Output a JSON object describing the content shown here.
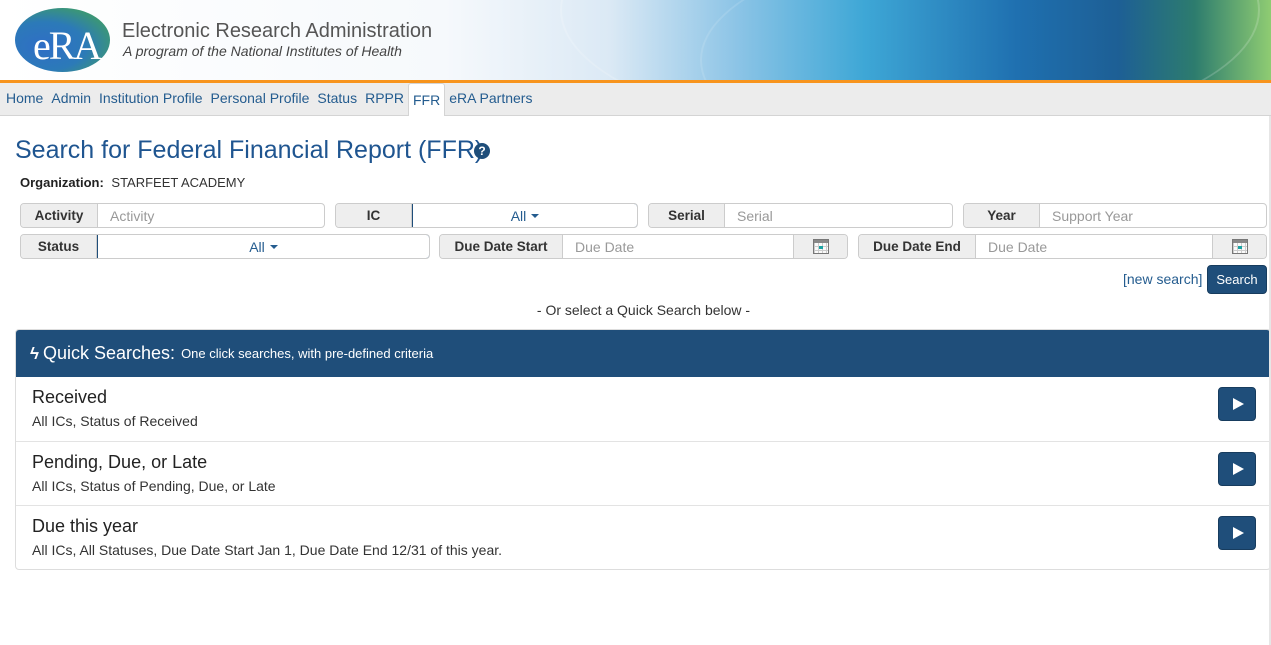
{
  "header": {
    "logo_text": "eRA",
    "title": "Electronic Research Administration",
    "subtitle": "A program of the National Institutes of Health",
    "accent_color": "#f7941d"
  },
  "nav": {
    "items": [
      {
        "label": "Home",
        "active": false
      },
      {
        "label": "Admin",
        "active": false
      },
      {
        "label": "Institution Profile",
        "active": false
      },
      {
        "label": "Personal Profile",
        "active": false
      },
      {
        "label": "Status",
        "active": false
      },
      {
        "label": "RPPR",
        "active": false
      },
      {
        "label": "FFR",
        "active": true
      },
      {
        "label": "eRA Partners",
        "active": false
      }
    ]
  },
  "page": {
    "title": "Search for Federal Financial Report (FFR)",
    "help_icon": "?",
    "organization_label": "Organization:",
    "organization_value": "STARFEET ACADEMY"
  },
  "search": {
    "activity": {
      "label": "Activity",
      "placeholder": "Activity",
      "value": ""
    },
    "ic": {
      "label": "IC",
      "value": "All"
    },
    "serial": {
      "label": "Serial",
      "placeholder": "Serial",
      "value": ""
    },
    "year": {
      "label": "Year",
      "placeholder": "Support Year",
      "value": ""
    },
    "status": {
      "label": "Status",
      "value": "All"
    },
    "due_date_start": {
      "label": "Due Date Start",
      "placeholder": "Due Date",
      "value": ""
    },
    "due_date_end": {
      "label": "Due Date End",
      "placeholder": "Due Date",
      "value": ""
    },
    "new_search_label": "[new search]",
    "search_button_label": "Search",
    "or_text": "- Or select a Quick Search below -"
  },
  "quick_searches": {
    "bolt_icon": "ϟ",
    "title": "Quick Searches:",
    "subtitle": "One click searches, with pre-defined criteria",
    "header_color": "#1f4e7a",
    "items": [
      {
        "name": "Received",
        "description": "All ICs, Status of Received"
      },
      {
        "name": "Pending, Due, or Late",
        "description": "All ICs, Status of Pending, Due, or Late"
      },
      {
        "name": "Due this year",
        "description": "All ICs, All Statuses, Due Date Start Jan 1, Due Date End 12/31 of this year."
      }
    ]
  }
}
